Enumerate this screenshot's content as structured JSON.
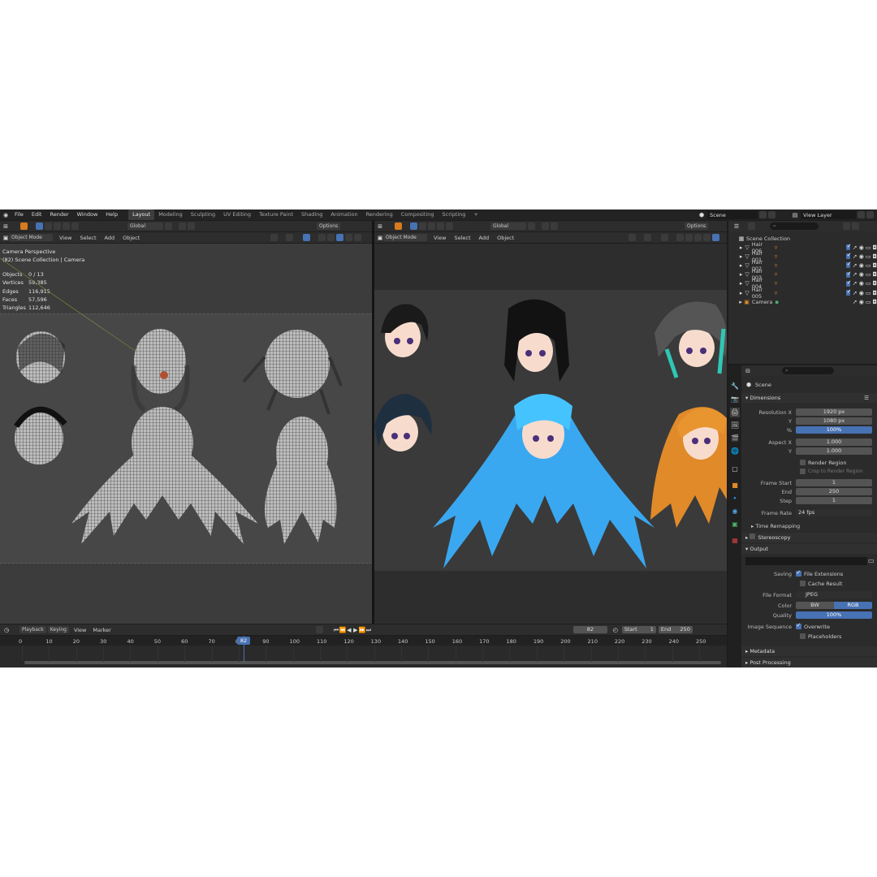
{
  "menu": [
    "File",
    "Edit",
    "Render",
    "Window",
    "Help"
  ],
  "workspaces": [
    "Layout",
    "Modeling",
    "Sculpting",
    "UV Editing",
    "Texture Paint",
    "Shading",
    "Animation",
    "Rendering",
    "Compositing",
    "Scripting"
  ],
  "active_workspace": "Layout",
  "plus": "+",
  "scene_name": "Scene",
  "view_layer": "View Layer",
  "left_viewport": {
    "orientation": "Global",
    "options": "Options",
    "mode": "Object Mode",
    "menus": [
      "View",
      "Select",
      "Add",
      "Object"
    ],
    "camera_title": "Camera Perspective",
    "collection_path": "(82) Scene Collection | Camera",
    "stats": [
      {
        "label": "Objects",
        "value": "0 / 13"
      },
      {
        "label": "Vertices",
        "value": "59,385"
      },
      {
        "label": "Edges",
        "value": "116,915"
      },
      {
        "label": "Faces",
        "value": "57,596"
      },
      {
        "label": "Triangles",
        "value": "112,646"
      }
    ]
  },
  "right_viewport": {
    "orientation": "Global",
    "options": "Options",
    "mode": "Object Mode",
    "menus": [
      "View",
      "Select",
      "Add",
      "Object"
    ]
  },
  "outliner": {
    "root": "Scene Collection",
    "items": [
      "Hair 006",
      "Hair 001",
      "Hair 002",
      "Hair 003",
      "Hair 004",
      "Hair 005",
      "Camera"
    ]
  },
  "properties": {
    "scene_label": "Scene",
    "dimensions": "Dimensions",
    "resolution_x_label": "Resolution X",
    "resolution_x": "1920 px",
    "y_label": "Y",
    "resolution_y": "1080 px",
    "percent_label": "%",
    "percent": "100%",
    "aspect_x_label": "Aspect X",
    "aspect_x": "1.000",
    "aspect_y_label": "Y",
    "aspect_y": "1.000",
    "render_region": "Render Region",
    "crop_region": "Crop to Render Region",
    "frame_start_label": "Frame Start",
    "frame_start": "1",
    "end_label": "End",
    "frame_end": "250",
    "step_label": "Step",
    "step": "1",
    "frame_rate_label": "Frame Rate",
    "frame_rate": "24 fps",
    "time_remapping": "Time Remapping",
    "stereoscopy": "Stereoscopy",
    "output": "Output",
    "saving_label": "Saving",
    "file_extensions": "File Extensions",
    "cache_result": "Cache Result",
    "file_format_label": "File Format",
    "file_format": "JPEG",
    "color_label": "Color",
    "color_bw": "BW",
    "color_rgb": "RGB",
    "quality_label": "Quality",
    "quality": "100%",
    "image_sequence_label": "Image Sequence",
    "overwrite": "Overwrite",
    "placeholders": "Placeholders",
    "metadata": "Metadata",
    "post_processing": "Post Processing"
  },
  "timeline": {
    "menus": [
      "Playback",
      "Keying",
      "View",
      "Marker"
    ],
    "current_frame": "82",
    "start_label": "Start",
    "start": "1",
    "end_label": "End",
    "end": "250",
    "ticks": [
      "0",
      "10",
      "20",
      "30",
      "40",
      "50",
      "60",
      "70",
      "80",
      "90",
      "100",
      "110",
      "120",
      "130",
      "140",
      "150",
      "160",
      "170",
      "180",
      "190",
      "200",
      "210",
      "220",
      "230",
      "240",
      "250"
    ]
  },
  "colors": {
    "accent": "#4772b3",
    "blue_hair": "#3aa8f0",
    "orange_hair": "#e08a2a",
    "playhead": "#4772b3"
  }
}
